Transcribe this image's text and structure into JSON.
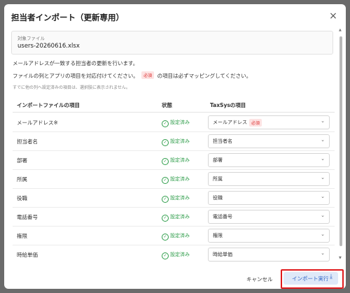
{
  "dialog": {
    "title": "担当者インポート（更新専用）",
    "close_icon": "×"
  },
  "file": {
    "label": "対象ファイル",
    "name": "users-20260616.xlsx"
  },
  "descriptions": {
    "line1": "メールアドレスが一致する担当者の更新を行います。",
    "line2_prefix": "ファイルの列とアプリの項目を対応付けてください。",
    "required_badge": "必須",
    "line2_suffix": "の項目は必ずマッピングしてください。",
    "line3": "すでに他の列へ設定済みの項目は、選択肢に表示されません。"
  },
  "table": {
    "headers": [
      "インポートファイルの項目",
      "状態",
      "TaxSysの項目"
    ],
    "status_icon": "✓",
    "chevron": "⌄",
    "rows": [
      {
        "name": "メールアドレス※",
        "status": "設定済み",
        "mapping": "メールアドレス",
        "required": "必須"
      },
      {
        "name": "担当者名",
        "status": "設定済み",
        "mapping": "担当者名"
      },
      {
        "name": "部署",
        "status": "設定済み",
        "mapping": "部署"
      },
      {
        "name": "所属",
        "status": "設定済み",
        "mapping": "所属"
      },
      {
        "name": "役職",
        "status": "設定済み",
        "mapping": "役職"
      },
      {
        "name": "電話番号",
        "status": "設定済み",
        "mapping": "電話番号"
      },
      {
        "name": "権限",
        "status": "設定済み",
        "mapping": "権限"
      },
      {
        "name": "時給単価",
        "status": "設定済み",
        "mapping": "時給単価"
      }
    ]
  },
  "footer": {
    "cancel_label": "キャンセル",
    "import_label": "インポート実行",
    "import_icon": "⤓"
  },
  "colors": {
    "accent": "#2d63c7",
    "success": "#2e9d4a",
    "required": "#d33333",
    "highlight": "#e0191c"
  }
}
